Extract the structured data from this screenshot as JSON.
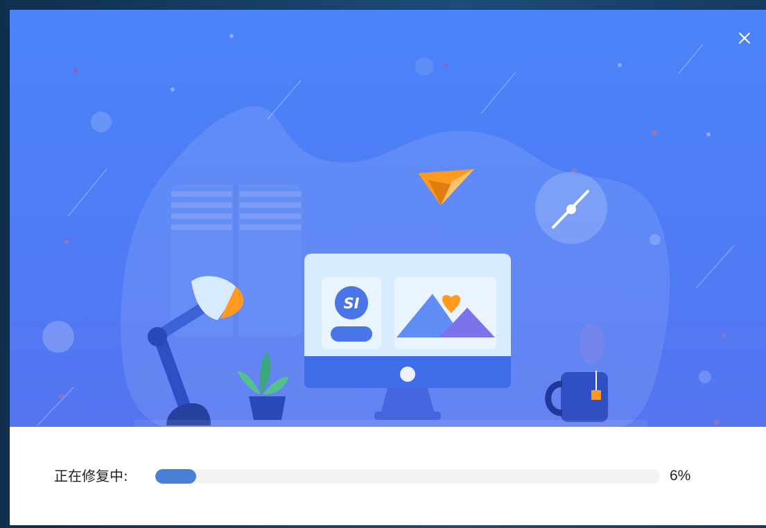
{
  "dialog": {
    "close_icon": "close-icon",
    "illustration": {
      "computer_badge_text": "SI",
      "icons": [
        "paper-plane-icon",
        "clock-icon",
        "desk-lamp-icon",
        "plant-icon",
        "monitor-icon",
        "mug-icon",
        "heart-icon"
      ]
    },
    "progress": {
      "label": "正在修复中:",
      "percent_text": "6%",
      "value": 0.06
    },
    "colors": {
      "banner_top": "#4b83f8",
      "progress_fill": "#4a7fd8",
      "progress_track": "#f3f3f3",
      "accent_orange": "#ff9a1f"
    }
  }
}
